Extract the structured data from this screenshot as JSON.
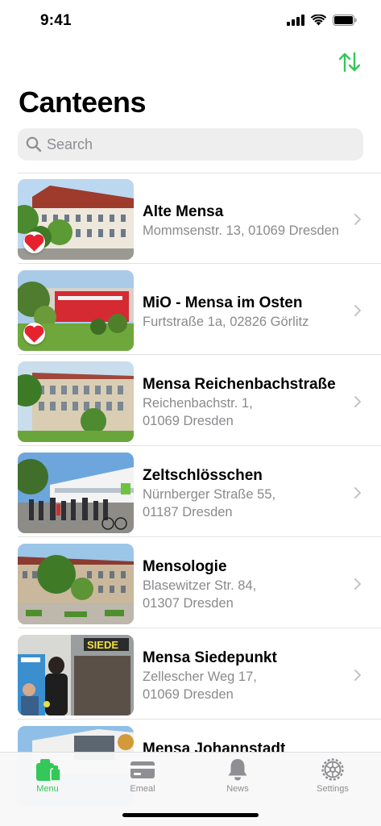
{
  "status_bar": {
    "time": "9:41"
  },
  "header": {
    "title": "Canteens",
    "sort_icon": "arrow-up-down-icon"
  },
  "search": {
    "placeholder": "Search"
  },
  "canteens": [
    {
      "name": "Alte Mensa",
      "address_line1": "Mommsenstr. 13, 01069 Dresden",
      "address_line2": "",
      "favorite": true
    },
    {
      "name": "MiO - Mensa im Osten",
      "address_line1": "Furtstraße 1a, 02826 Görlitz",
      "address_line2": "",
      "favorite": true
    },
    {
      "name": "Mensa Reichenbachstraße",
      "address_line1": "Reichenbachstr. 1,",
      "address_line2": "01069 Dresden",
      "favorite": false
    },
    {
      "name": "Zeltschlösschen",
      "address_line1": "Nürnberger Straße 55,",
      "address_line2": "01187 Dresden",
      "favorite": false
    },
    {
      "name": "Mensologie",
      "address_line1": "Blasewitzer Str. 84,",
      "address_line2": "01307 Dresden",
      "favorite": false
    },
    {
      "name": "Mensa Siedepunkt",
      "address_line1": "Zellescher Weg 17,",
      "address_line2": "01069 Dresden",
      "favorite": false
    },
    {
      "name": "Mensa Johannstadt",
      "address_line1": "",
      "address_line2": "",
      "favorite": false
    }
  ],
  "photo_texts": {
    "siedepunkt_sign": "SIEDE"
  },
  "tabs": [
    {
      "label": "Menu",
      "icon": "menu-bag-icon",
      "active": true
    },
    {
      "label": "Emeal",
      "icon": "card-icon",
      "active": false
    },
    {
      "label": "News",
      "icon": "bell-icon",
      "active": false
    },
    {
      "label": "Settings",
      "icon": "gear-icon",
      "active": false
    }
  ],
  "colors": {
    "accent": "#34c759",
    "favorite": "#e8212e",
    "secondary_text": "#8a8a8e",
    "tab_inactive": "#8e8e93"
  }
}
